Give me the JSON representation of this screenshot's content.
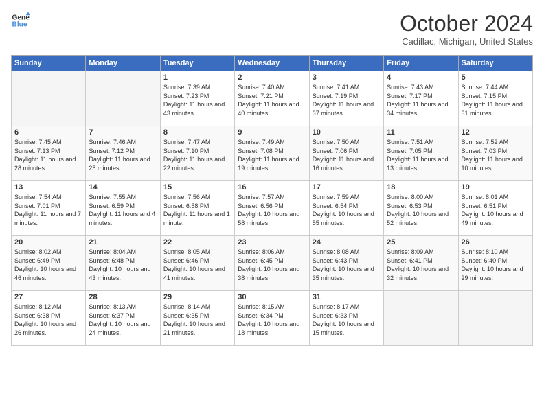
{
  "header": {
    "logo_line1": "General",
    "logo_line2": "Blue",
    "month": "October 2024",
    "location": "Cadillac, Michigan, United States"
  },
  "days_of_week": [
    "Sunday",
    "Monday",
    "Tuesday",
    "Wednesday",
    "Thursday",
    "Friday",
    "Saturday"
  ],
  "weeks": [
    [
      {
        "num": "",
        "info": ""
      },
      {
        "num": "",
        "info": ""
      },
      {
        "num": "1",
        "info": "Sunrise: 7:39 AM\nSunset: 7:23 PM\nDaylight: 11 hours and 43 minutes."
      },
      {
        "num": "2",
        "info": "Sunrise: 7:40 AM\nSunset: 7:21 PM\nDaylight: 11 hours and 40 minutes."
      },
      {
        "num": "3",
        "info": "Sunrise: 7:41 AM\nSunset: 7:19 PM\nDaylight: 11 hours and 37 minutes."
      },
      {
        "num": "4",
        "info": "Sunrise: 7:43 AM\nSunset: 7:17 PM\nDaylight: 11 hours and 34 minutes."
      },
      {
        "num": "5",
        "info": "Sunrise: 7:44 AM\nSunset: 7:15 PM\nDaylight: 11 hours and 31 minutes."
      }
    ],
    [
      {
        "num": "6",
        "info": "Sunrise: 7:45 AM\nSunset: 7:13 PM\nDaylight: 11 hours and 28 minutes."
      },
      {
        "num": "7",
        "info": "Sunrise: 7:46 AM\nSunset: 7:12 PM\nDaylight: 11 hours and 25 minutes."
      },
      {
        "num": "8",
        "info": "Sunrise: 7:47 AM\nSunset: 7:10 PM\nDaylight: 11 hours and 22 minutes."
      },
      {
        "num": "9",
        "info": "Sunrise: 7:49 AM\nSunset: 7:08 PM\nDaylight: 11 hours and 19 minutes."
      },
      {
        "num": "10",
        "info": "Sunrise: 7:50 AM\nSunset: 7:06 PM\nDaylight: 11 hours and 16 minutes."
      },
      {
        "num": "11",
        "info": "Sunrise: 7:51 AM\nSunset: 7:05 PM\nDaylight: 11 hours and 13 minutes."
      },
      {
        "num": "12",
        "info": "Sunrise: 7:52 AM\nSunset: 7:03 PM\nDaylight: 11 hours and 10 minutes."
      }
    ],
    [
      {
        "num": "13",
        "info": "Sunrise: 7:54 AM\nSunset: 7:01 PM\nDaylight: 11 hours and 7 minutes."
      },
      {
        "num": "14",
        "info": "Sunrise: 7:55 AM\nSunset: 6:59 PM\nDaylight: 11 hours and 4 minutes."
      },
      {
        "num": "15",
        "info": "Sunrise: 7:56 AM\nSunset: 6:58 PM\nDaylight: 11 hours and 1 minute."
      },
      {
        "num": "16",
        "info": "Sunrise: 7:57 AM\nSunset: 6:56 PM\nDaylight: 10 hours and 58 minutes."
      },
      {
        "num": "17",
        "info": "Sunrise: 7:59 AM\nSunset: 6:54 PM\nDaylight: 10 hours and 55 minutes."
      },
      {
        "num": "18",
        "info": "Sunrise: 8:00 AM\nSunset: 6:53 PM\nDaylight: 10 hours and 52 minutes."
      },
      {
        "num": "19",
        "info": "Sunrise: 8:01 AM\nSunset: 6:51 PM\nDaylight: 10 hours and 49 minutes."
      }
    ],
    [
      {
        "num": "20",
        "info": "Sunrise: 8:02 AM\nSunset: 6:49 PM\nDaylight: 10 hours and 46 minutes."
      },
      {
        "num": "21",
        "info": "Sunrise: 8:04 AM\nSunset: 6:48 PM\nDaylight: 10 hours and 43 minutes."
      },
      {
        "num": "22",
        "info": "Sunrise: 8:05 AM\nSunset: 6:46 PM\nDaylight: 10 hours and 41 minutes."
      },
      {
        "num": "23",
        "info": "Sunrise: 8:06 AM\nSunset: 6:45 PM\nDaylight: 10 hours and 38 minutes."
      },
      {
        "num": "24",
        "info": "Sunrise: 8:08 AM\nSunset: 6:43 PM\nDaylight: 10 hours and 35 minutes."
      },
      {
        "num": "25",
        "info": "Sunrise: 8:09 AM\nSunset: 6:41 PM\nDaylight: 10 hours and 32 minutes."
      },
      {
        "num": "26",
        "info": "Sunrise: 8:10 AM\nSunset: 6:40 PM\nDaylight: 10 hours and 29 minutes."
      }
    ],
    [
      {
        "num": "27",
        "info": "Sunrise: 8:12 AM\nSunset: 6:38 PM\nDaylight: 10 hours and 26 minutes."
      },
      {
        "num": "28",
        "info": "Sunrise: 8:13 AM\nSunset: 6:37 PM\nDaylight: 10 hours and 24 minutes."
      },
      {
        "num": "29",
        "info": "Sunrise: 8:14 AM\nSunset: 6:35 PM\nDaylight: 10 hours and 21 minutes."
      },
      {
        "num": "30",
        "info": "Sunrise: 8:15 AM\nSunset: 6:34 PM\nDaylight: 10 hours and 18 minutes."
      },
      {
        "num": "31",
        "info": "Sunrise: 8:17 AM\nSunset: 6:33 PM\nDaylight: 10 hours and 15 minutes."
      },
      {
        "num": "",
        "info": ""
      },
      {
        "num": "",
        "info": ""
      }
    ]
  ]
}
